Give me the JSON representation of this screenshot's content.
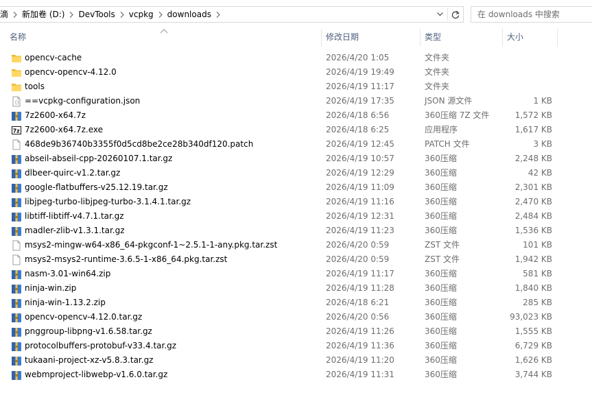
{
  "address": {
    "crumbs": [
      "滴",
      "新加卷 (D:)",
      "DevTools",
      "vcpkg",
      "downloads"
    ]
  },
  "search": {
    "placeholder": "在 downloads 中搜索"
  },
  "columns": {
    "name": "名称",
    "date": "修改日期",
    "type": "类型",
    "size": "大小"
  },
  "colors": {
    "folder": "#ffd766",
    "header_text": "#4c607a",
    "detail_text": "#6d6d6d",
    "archive_blue": "#3b7bd6"
  },
  "files": [
    {
      "name": "opencv-cache",
      "date": "2026/4/20 1:05",
      "type": "文件夹",
      "size": "",
      "icon": "folder-icon"
    },
    {
      "name": "opencv-opencv-4.12.0",
      "date": "2026/4/19 19:49",
      "type": "文件夹",
      "size": "",
      "icon": "folder-icon"
    },
    {
      "name": "tools",
      "date": "2026/4/19 11:17",
      "type": "文件夹",
      "size": "",
      "icon": "folder-icon"
    },
    {
      "name": "==vcpkg-configuration.json",
      "date": "2026/4/19 17:35",
      "type": "JSON 源文件",
      "size": "1 KB",
      "icon": "json-file-icon"
    },
    {
      "name": "7z2600-x64.7z",
      "date": "2026/4/18 6:56",
      "type": "360压缩 7Z 文件",
      "size": "1,572 KB",
      "icon": "archive-icon"
    },
    {
      "name": "7z2600-x64.7z.exe",
      "date": "2026/4/18 6:25",
      "type": "应用程序",
      "size": "1,617 KB",
      "icon": "7zip-exe-icon"
    },
    {
      "name": "468de9b36740b3355f0d5cd8be2ce28b340df120.patch",
      "date": "2026/4/19 12:45",
      "type": "PATCH 文件",
      "size": "3 KB",
      "icon": "blank-file-icon"
    },
    {
      "name": "abseil-abseil-cpp-20260107.1.tar.gz",
      "date": "2026/4/19 10:57",
      "type": "360压缩",
      "size": "2,248 KB",
      "icon": "archive-icon"
    },
    {
      "name": "dlbeer-quirc-v1.2.tar.gz",
      "date": "2026/4/19 12:29",
      "type": "360压缩",
      "size": "42 KB",
      "icon": "archive-icon"
    },
    {
      "name": "google-flatbuffers-v25.12.19.tar.gz",
      "date": "2026/4/19 11:09",
      "type": "360压缩",
      "size": "2,301 KB",
      "icon": "archive-icon"
    },
    {
      "name": "libjpeg-turbo-libjpeg-turbo-3.1.4.1.tar.gz",
      "date": "2026/4/19 11:16",
      "type": "360压缩",
      "size": "2,470 KB",
      "icon": "archive-icon"
    },
    {
      "name": "libtiff-libtiff-v4.7.1.tar.gz",
      "date": "2026/4/19 12:31",
      "type": "360压缩",
      "size": "2,484 KB",
      "icon": "archive-icon"
    },
    {
      "name": "madler-zlib-v1.3.1.tar.gz",
      "date": "2026/4/19 11:23",
      "type": "360压缩",
      "size": "1,536 KB",
      "icon": "archive-icon"
    },
    {
      "name": "msys2-mingw-w64-x86_64-pkgconf-1~2.5.1-1-any.pkg.tar.zst",
      "date": "2026/4/20 0:59",
      "type": "ZST 文件",
      "size": "101 KB",
      "icon": "blank-file-icon"
    },
    {
      "name": "msys2-msys2-runtime-3.6.5-1-x86_64.pkg.tar.zst",
      "date": "2026/4/20 0:59",
      "type": "ZST 文件",
      "size": "1,942 KB",
      "icon": "blank-file-icon"
    },
    {
      "name": "nasm-3.01-win64.zip",
      "date": "2026/4/19 11:17",
      "type": "360压缩",
      "size": "581 KB",
      "icon": "archive-icon"
    },
    {
      "name": "ninja-win.zip",
      "date": "2026/4/19 11:28",
      "type": "360压缩",
      "size": "1,840 KB",
      "icon": "archive-icon"
    },
    {
      "name": "ninja-win-1.13.2.zip",
      "date": "2026/4/18 6:21",
      "type": "360压缩",
      "size": "285 KB",
      "icon": "archive-icon"
    },
    {
      "name": "opencv-opencv-4.12.0.tar.gz",
      "date": "2026/4/20 0:56",
      "type": "360压缩",
      "size": "93,023 KB",
      "icon": "archive-icon"
    },
    {
      "name": "pnggroup-libpng-v1.6.58.tar.gz",
      "date": "2026/4/19 11:26",
      "type": "360压缩",
      "size": "1,555 KB",
      "icon": "archive-icon"
    },
    {
      "name": "protocolbuffers-protobuf-v33.4.tar.gz",
      "date": "2026/4/19 11:36",
      "type": "360压缩",
      "size": "6,729 KB",
      "icon": "archive-icon"
    },
    {
      "name": "tukaani-project-xz-v5.8.3.tar.gz",
      "date": "2026/4/19 11:20",
      "type": "360压缩",
      "size": "1,626 KB",
      "icon": "archive-icon"
    },
    {
      "name": "webmproject-libwebp-v1.6.0.tar.gz",
      "date": "2026/4/19 11:31",
      "type": "360压缩",
      "size": "3,744 KB",
      "icon": "archive-icon"
    }
  ]
}
